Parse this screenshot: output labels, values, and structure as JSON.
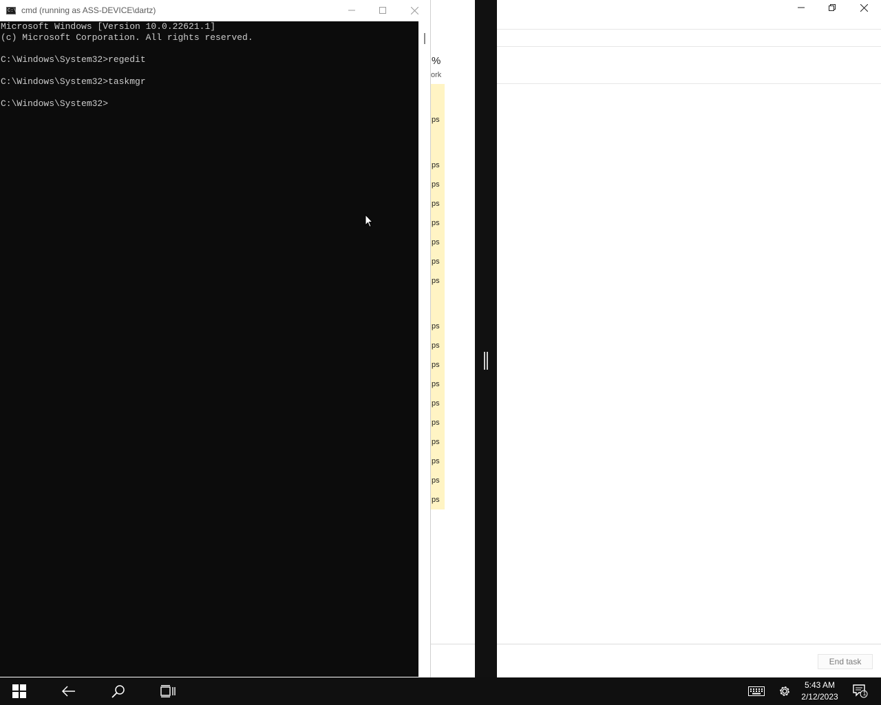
{
  "cmd_window": {
    "title": "cmd (running as ASS-DEVICE\\dartz)",
    "icon": "console-icon",
    "icon_text": "C:\\",
    "lines": [
      "Microsoft Windows [Version 10.0.22621.1]",
      "(c) Microsoft Corporation. All rights reserved.",
      "",
      "C:\\Windows\\System32>regedit",
      "",
      "C:\\Windows\\System32>taskmgr",
      "",
      "C:\\Windows\\System32>"
    ]
  },
  "task_manager_peek": {
    "column_header_value": "%",
    "column_header_label": "ork",
    "cells": [
      "ps",
      "",
      "ps",
      "ps",
      "ps",
      "ps",
      "ps",
      "ps",
      "ps",
      "",
      "ps",
      "ps",
      "ps",
      "ps",
      "ps",
      "ps",
      "ps",
      "ps",
      "ps",
      "ps"
    ]
  },
  "right_window": {
    "end_task_label": "End task",
    "controls": [
      "minimize-icon",
      "restore-icon",
      "close-icon"
    ]
  },
  "taskbar": {
    "icons": [
      "windows-start-icon",
      "back-arrow-icon",
      "search-icon",
      "task-view-icon",
      "keyboard-icon",
      "settings-gear-icon",
      "notifications-icon"
    ],
    "time": "5:43 AM",
    "date": "2/12/2023",
    "notification_count": "1"
  },
  "colors": {
    "console_bg": "#0c0c0c",
    "console_fg": "#cccccc",
    "taskbar_bg": "#101010",
    "highlight_column": "#fff4c4"
  }
}
